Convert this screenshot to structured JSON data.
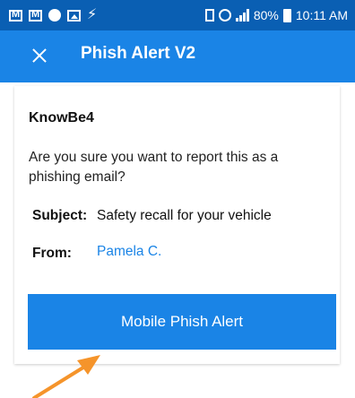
{
  "status_bar": {
    "left_icons": [
      "gmail-icon",
      "gmail-icon",
      "slack-icon",
      "image-icon",
      "flash-icon"
    ],
    "battery_percent": "80%",
    "time": "10:11 AM"
  },
  "app_bar": {
    "title": "Phish Alert V2"
  },
  "dialog": {
    "sender_name": "KnowBe4",
    "question": "Are you sure you want to report this as a phishing email?",
    "subject_label": "Subject:",
    "subject_value": "Safety recall for your vehicle",
    "from_label": "From:",
    "from_value": "Pamela C.",
    "button_label": "Mobile Phish Alert"
  },
  "colors": {
    "status_bar": "#0a5fb3",
    "app_bar": "#1a84e6",
    "button": "#1a84e6",
    "arrow": "#f5942b"
  }
}
